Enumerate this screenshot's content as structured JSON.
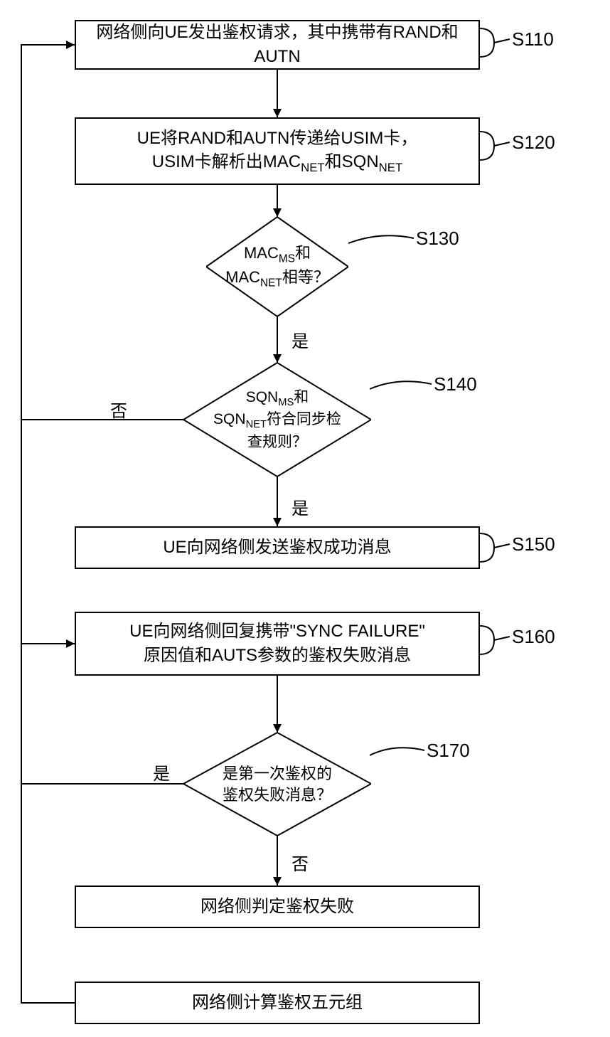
{
  "steps": {
    "s110": {
      "label": "S110",
      "text": "网络侧向UE发出鉴权请求，其中携带有RAND和AUTN"
    },
    "s120": {
      "label": "S120",
      "text_line1": "UE将RAND和AUTN传递给USIM卡，",
      "text_line2_pre": "USIM卡解析出MAC",
      "text_line2_sub1": "NET",
      "text_line2_mid": "和SQN",
      "text_line2_sub2": "NET"
    },
    "s130": {
      "label": "S130",
      "line1_pre": "MAC",
      "line1_sub": "MS",
      "line1_post": "和",
      "line2_pre": "MAC",
      "line2_sub": "NET",
      "line2_post": "相等？"
    },
    "s140": {
      "label": "S140",
      "line1_pre": "SQN",
      "line1_sub": "MS",
      "line1_post": "和",
      "line2_pre": "SQN",
      "line2_sub": "NET",
      "line2_post": "符合同步检",
      "line3": "查规则？"
    },
    "s150": {
      "label": "S150",
      "text": "UE向网络侧发送鉴权成功消息"
    },
    "s160": {
      "label": "S160",
      "text_line1": "UE向网络侧回复携带\"SYNC FAILURE\"",
      "text_line2": "原因值和AUTS参数的鉴权失败消息"
    },
    "s170": {
      "label": "S170",
      "text_line1": "是第一次鉴权的",
      "text_line2": "鉴权失败消息？"
    },
    "box8": {
      "text": "网络侧判定鉴权失败"
    },
    "box9": {
      "text": "网络侧计算鉴权五元组"
    }
  },
  "labels": {
    "yes": "是",
    "no": "否"
  }
}
